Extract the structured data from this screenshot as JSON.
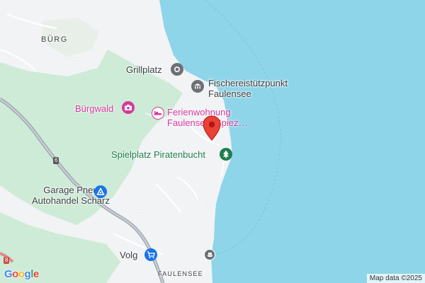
{
  "map": {
    "places": {
      "burg": "BÜRG",
      "faulensee": "FAULENSEE"
    },
    "pois": {
      "grillplatz": "Grillplatz",
      "fischerei_line1": "Fischereistützpunkt",
      "fischerei_line2": "Faulensee",
      "burgwald": "Bürgwald",
      "ferien_line1": "Ferienwohnung",
      "ferien_line2": "Faulensee, Spiez…",
      "spielplatz": "Spielplatz Piratenbucht",
      "garage_line1": "Garage Pneu",
      "garage_line2": "Autohandel Schärz",
      "volg": "Volg"
    },
    "road_shields": {
      "route_6": "6",
      "route_8": "8"
    },
    "attribution": "Map data ©2025",
    "logo_letters": [
      "G",
      "o",
      "o",
      "g",
      "l",
      "e"
    ],
    "colors": {
      "water": "#8ed5ea",
      "land": "#f2f3f5",
      "forest": "#cdebd6",
      "marker_red": "#e94235",
      "pink": "#d6399e",
      "green": "#1e7f4e",
      "gray_icon": "#6b7075",
      "blue_icon": "#1a73e8"
    },
    "icons": {
      "grillplatz": "place-dot-icon",
      "fischerei": "building-icon",
      "burgwald": "camera-icon",
      "ferien": "bed-icon",
      "marker": "location-pin-icon",
      "spielplatz": "tree-icon",
      "garage": "wrench-icon",
      "volg": "shopping-cart-icon",
      "ferry": "ferry-icon"
    }
  }
}
